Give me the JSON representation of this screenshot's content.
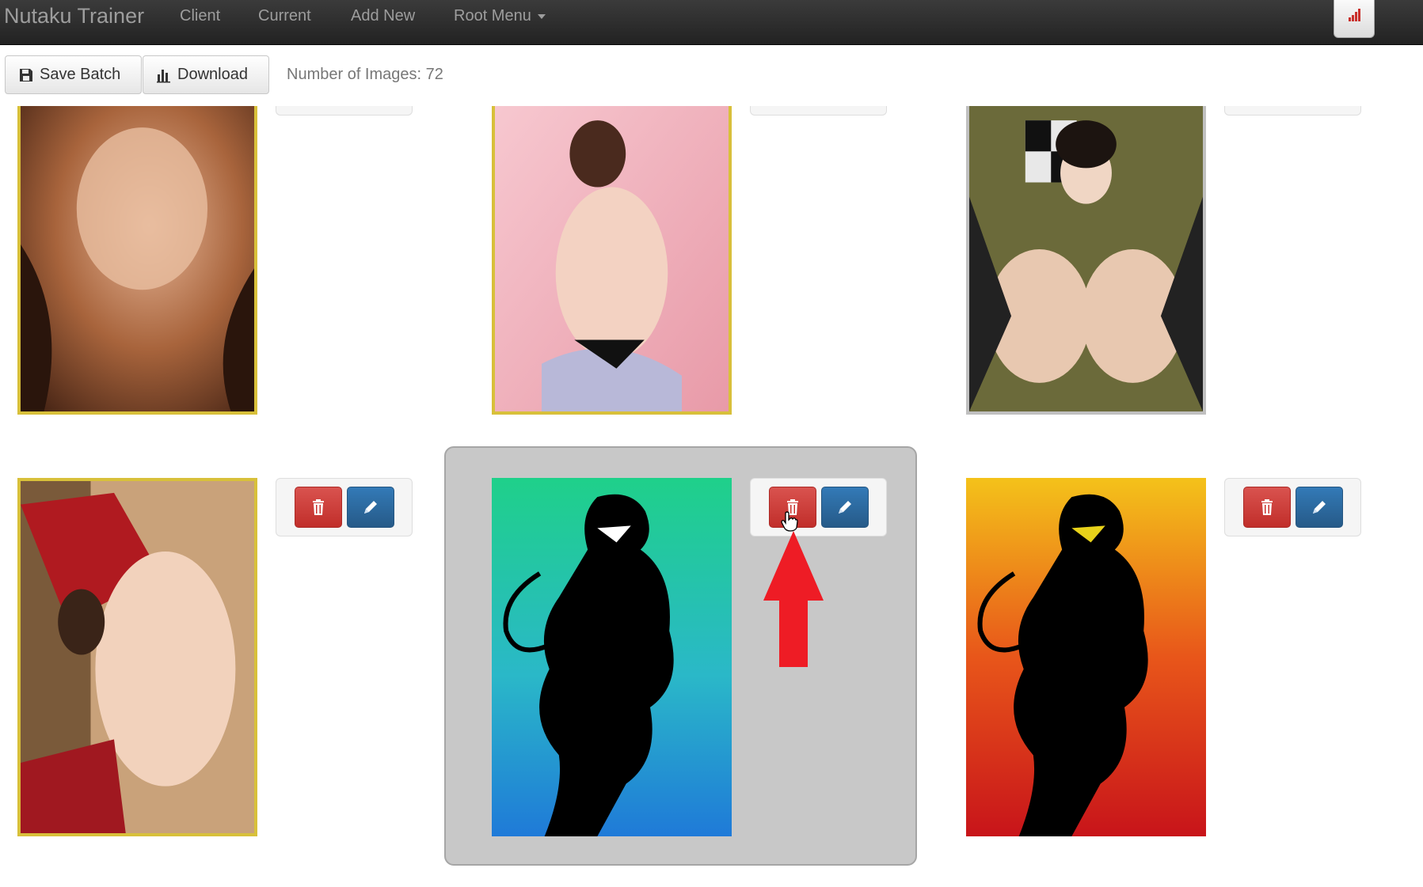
{
  "navbar": {
    "brand": "Nutaku Trainer",
    "items": [
      {
        "label": "Client"
      },
      {
        "label": "Current"
      },
      {
        "label": "Add New"
      },
      {
        "label": "Root Menu"
      }
    ],
    "signal_icon": "signal-bars-icon"
  },
  "toolbar": {
    "save_label": "Save Batch",
    "save_icon": "save-icon",
    "download_label": "Download",
    "download_icon": "bar-chart-icon",
    "count_label": "Number of Images: 72"
  },
  "cards": [
    {
      "frame": "gold",
      "art": "photo-warm-brown"
    },
    {
      "frame": "gold",
      "art": "photo-pink"
    },
    {
      "frame": "silver",
      "art": "photo-olive"
    },
    {
      "frame": "gold",
      "art": "photo-tan-red"
    },
    {
      "frame": "none",
      "art": "silhouette-teal-blue",
      "selected": true
    },
    {
      "frame": "none",
      "art": "silhouette-red-orange"
    }
  ],
  "actions": {
    "delete_icon": "trash-icon",
    "edit_icon": "pencil-icon"
  },
  "colors": {
    "navbar": "#2b2b2b",
    "delete_button": "#c9302c",
    "edit_button": "#2d6ca2",
    "selected_panel": "#c8c8c8",
    "annotation_arrow": "#ee1c25",
    "gold_frame": "#d8c03a"
  }
}
